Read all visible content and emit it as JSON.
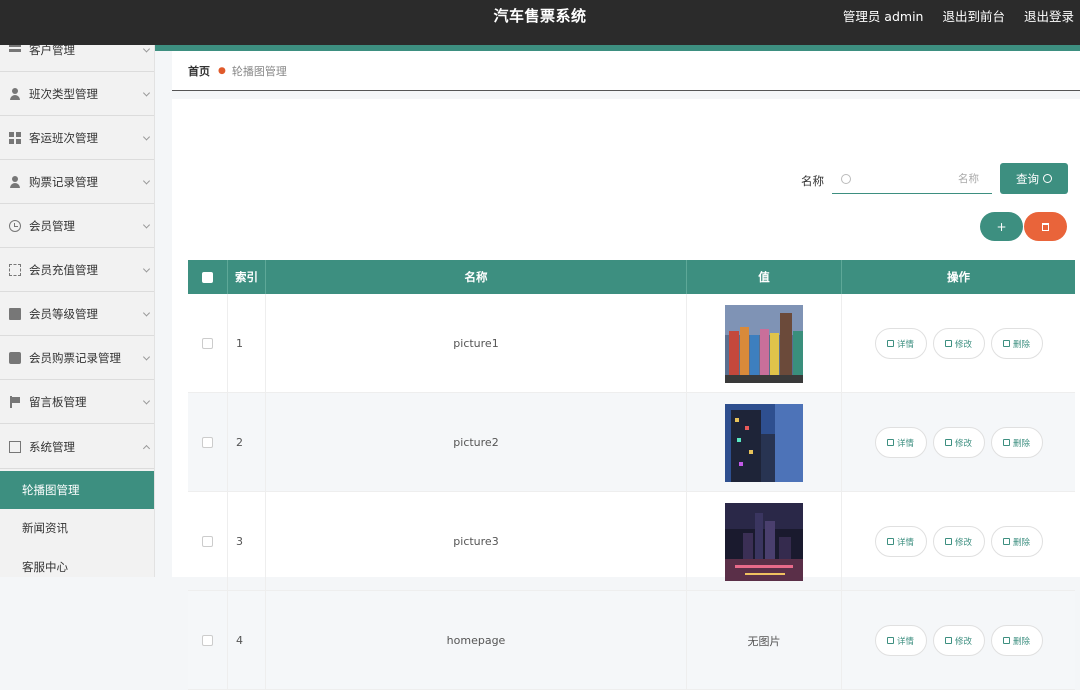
{
  "header": {
    "title": "汽车售票系统",
    "user": "管理员 admin",
    "front_link": "退出到前台",
    "logout": "退出登录"
  },
  "sidebar": {
    "items": [
      {
        "label": "客户管理",
        "icon": "list-icon"
      },
      {
        "label": "班次类型管理",
        "icon": "person-icon"
      },
      {
        "label": "客运班次管理",
        "icon": "grid-icon"
      },
      {
        "label": "购票记录管理",
        "icon": "person-icon"
      },
      {
        "label": "会员管理",
        "icon": "clock-icon"
      },
      {
        "label": "会员充值管理",
        "icon": "frame-icon"
      },
      {
        "label": "会员等级管理",
        "icon": "clipboard-icon"
      },
      {
        "label": "会员购票记录管理",
        "icon": "chat-icon"
      },
      {
        "label": "留言板管理",
        "icon": "flag-icon"
      },
      {
        "label": "系统管理",
        "icon": "system-icon"
      }
    ],
    "sub_items": [
      {
        "label": "轮播图管理"
      },
      {
        "label": "新闻资讯"
      },
      {
        "label": "客服中心"
      }
    ]
  },
  "breadcrumb": {
    "home": "首页",
    "current": "轮播图管理"
  },
  "search": {
    "label": "名称",
    "placeholder": "名称",
    "value": "",
    "button": "查询"
  },
  "actions": {
    "add": "+"
  },
  "table": {
    "headers": {
      "index": "索引",
      "name": "名称",
      "value": "值",
      "ops": "操作"
    },
    "rows": [
      {
        "index": "1",
        "name": "picture1",
        "value": "",
        "image": "image-1"
      },
      {
        "index": "2",
        "name": "picture2",
        "value": "",
        "image": "image-2"
      },
      {
        "index": "3",
        "name": "picture3",
        "value": "",
        "image": "image-3"
      },
      {
        "index": "4",
        "name": "homepage",
        "value": "无图片",
        "image": ""
      }
    ],
    "ops": {
      "detail": "详情",
      "edit": "修改",
      "delete": "删除"
    }
  },
  "colors": {
    "accent": "#3d8f80",
    "danger": "#e9643a",
    "topbar": "#2b2b2b"
  }
}
